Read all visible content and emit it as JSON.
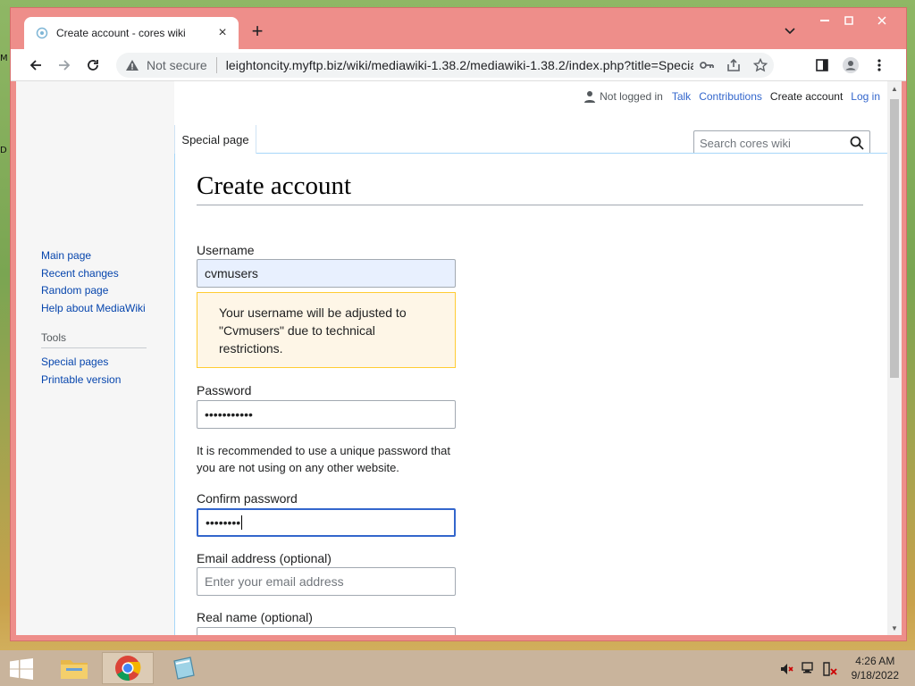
{
  "browser": {
    "tab_title": "Create account - cores wiki",
    "new_tab_symbol": "+",
    "address": {
      "security_label": "Not secure",
      "url": "leightoncity.myftp.biz/wiki/mediawiki-1.38.2/mediawiki-1.38.2/index.php?title=Special:C..."
    }
  },
  "wiki": {
    "personal": {
      "not_logged_in": "Not logged in",
      "talk": "Talk",
      "contributions": "Contributions",
      "create_account": "Create account",
      "log_in": "Log in"
    },
    "tab_special": "Special page",
    "search_placeholder": "Search cores wiki",
    "nav": {
      "items": [
        "Main page",
        "Recent changes",
        "Random page",
        "Help about MediaWiki"
      ],
      "tools_heading": "Tools",
      "tools": [
        "Special pages",
        "Printable version"
      ]
    },
    "page_title": "Create account",
    "form": {
      "username_label": "Username",
      "username_value": "cvmusers",
      "username_notice": "Your username will be adjusted to \"Cvmusers\" due to technical restrictions.",
      "password_label": "Password",
      "password_value": "•••••••••••",
      "password_hint": "It is recommended to use a unique password that you are not using on any other website.",
      "confirm_label": "Confirm password",
      "confirm_value": "••••••••",
      "email_label": "Email address (optional)",
      "email_placeholder": "Enter your email address",
      "realname_label": "Real name (optional)"
    }
  },
  "desktop": {
    "edge_letters": [
      "M",
      "D"
    ]
  },
  "taskbar": {
    "time": "4:26 AM",
    "date": "9/18/2022"
  }
}
